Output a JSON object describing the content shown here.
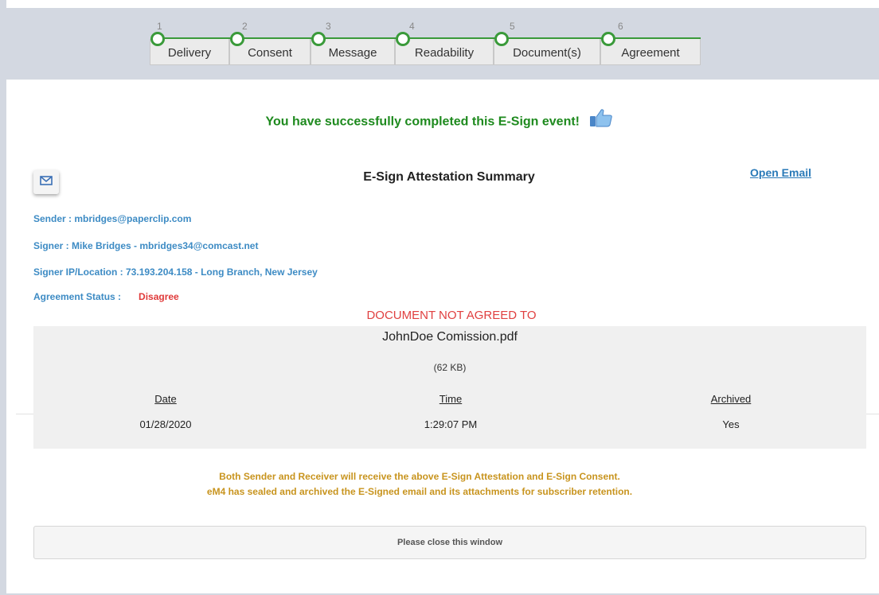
{
  "steps": [
    {
      "num": "1",
      "label": "Delivery"
    },
    {
      "num": "2",
      "label": "Consent"
    },
    {
      "num": "3",
      "label": "Message"
    },
    {
      "num": "4",
      "label": "Readability"
    },
    {
      "num": "5",
      "label": "Document(s)"
    },
    {
      "num": "6",
      "label": "Agreement"
    }
  ],
  "success_message": "You have successfully completed this E-Sign event!",
  "summary": {
    "title": "E-Sign Attestation Summary",
    "open_email": "Open Email"
  },
  "info": {
    "sender": "Sender : mbridges@paperclip.com",
    "signer": "Signer : Mike Bridges - mbridges34@comcast.net",
    "ip_location": "Signer IP/Location : 73.193.204.158 - Long Branch, New Jersey",
    "status_label": "Agreement Status :",
    "status_value": "Disagree"
  },
  "not_agreed": "DOCUMENT NOT AGREED TO",
  "document": {
    "name": "JohnDoe Comission.pdf",
    "size": "(62 KB)",
    "headers": {
      "date": "Date",
      "time": "Time",
      "archived": "Archived"
    },
    "values": {
      "date": "01/28/2020",
      "time": "1:29:07 PM",
      "archived": "Yes"
    }
  },
  "notes": {
    "line1": "Both Sender and Receiver will receive the above E-Sign Attestation and E-Sign Consent.",
    "line2": "eM4 has sealed and archived the E-Signed email and its attachments for subscriber retention."
  },
  "close_label": "Please close this window",
  "colors": {
    "success": "#1e8a1e",
    "link": "#2a7ab8",
    "info": "#3d8bc4",
    "alert": "#e03a3a",
    "note": "#c8941e",
    "step_line": "#3a9a3a"
  },
  "icons": [
    "thumbs-up-icon",
    "envelope-icon"
  ]
}
